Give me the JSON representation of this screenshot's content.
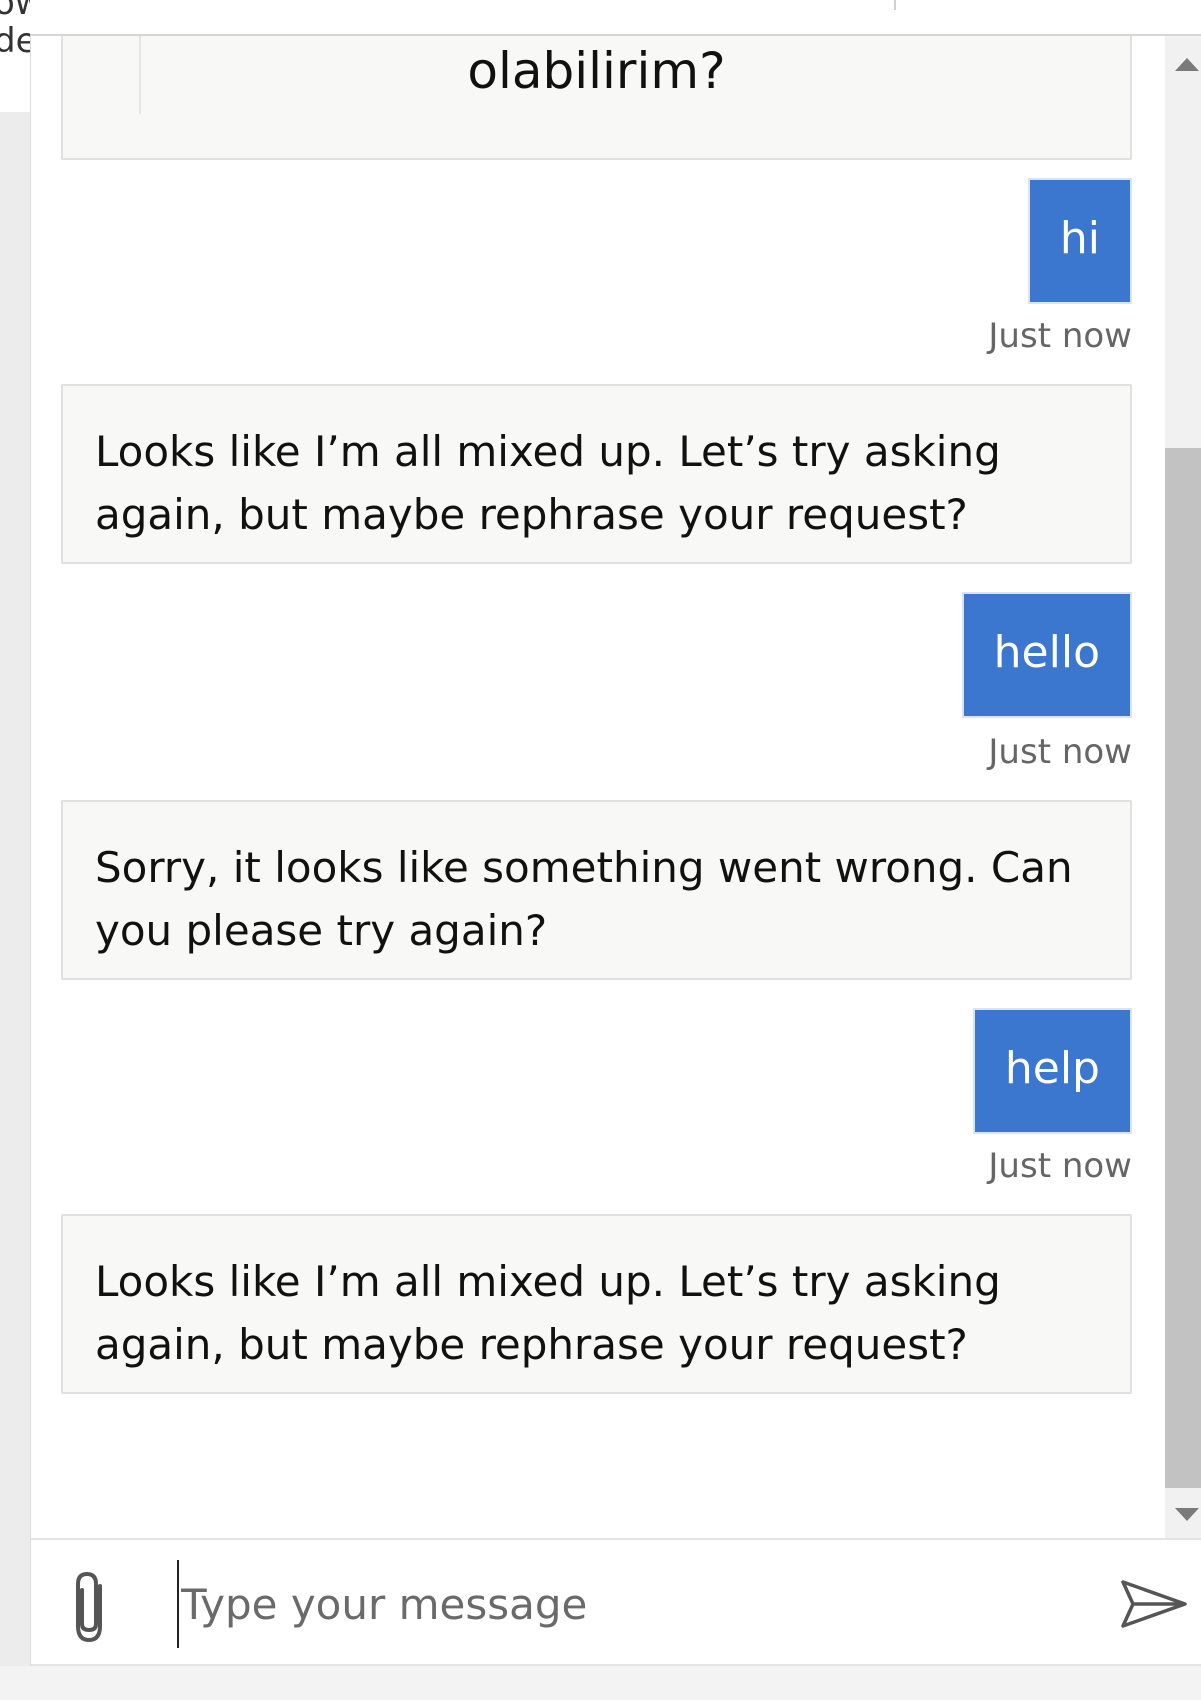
{
  "background_page": {
    "fragment_line1": "ow",
    "fragment_line2": "de"
  },
  "chat": {
    "messages": [
      {
        "from": "bot",
        "text": "olabilirim?"
      },
      {
        "from": "user",
        "text": "hi",
        "timestamp": "Just now"
      },
      {
        "from": "bot",
        "text": "Looks like I’m all mixed up. Let’s try asking again, but maybe rephrase your request?"
      },
      {
        "from": "user",
        "text": "hello",
        "timestamp": "Just now"
      },
      {
        "from": "bot",
        "text": "Sorry, it looks like something went wrong. Can you please try again?"
      },
      {
        "from": "user",
        "text": "help",
        "timestamp": "Just now"
      },
      {
        "from": "bot",
        "text": "Looks like I’m all mixed up. Let’s try asking again, but maybe rephrase your request?"
      }
    ]
  },
  "composer": {
    "placeholder": "Type your message",
    "value": "",
    "attach_icon": "paperclip-icon",
    "send_icon": "send-icon"
  },
  "colors": {
    "user_bubble": "#3b76cf",
    "bot_bubble": "#f8f8f7",
    "scroll_thumb": "#c2c2c2"
  }
}
